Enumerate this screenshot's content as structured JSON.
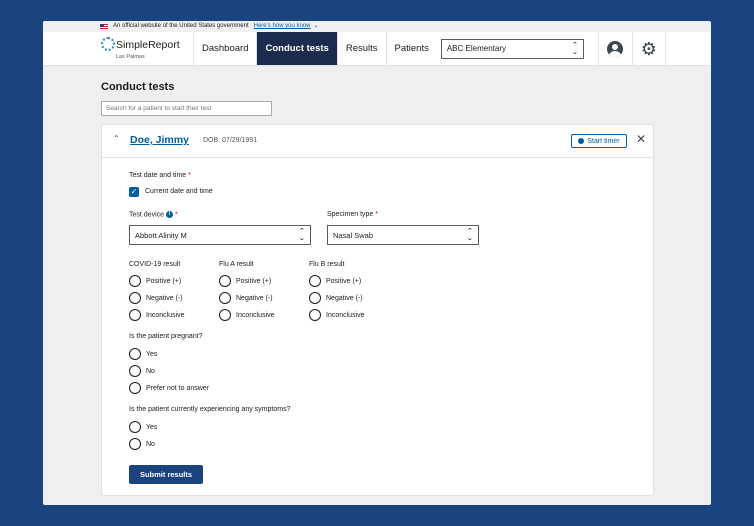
{
  "banner": {
    "text": "An official website of the United States government",
    "link": "Here's how you know"
  },
  "app": {
    "name": "SimpleReport",
    "site": "Las Palmas"
  },
  "nav": {
    "dashboard": "Dashboard",
    "conduct": "Conduct tests",
    "results": "Results",
    "patients": "Patients"
  },
  "facility": {
    "selected": "ABC Elementary"
  },
  "page": {
    "title": "Conduct tests"
  },
  "search": {
    "placeholder": "Search for a patient to start their test"
  },
  "patient": {
    "name": "Doe, Jimmy",
    "dob": "DOB: 07/29/1991",
    "timer_label": "Start timer"
  },
  "form": {
    "datetime_label": "Test date and time",
    "current_datetime_label": "Current date and time",
    "current_datetime_checked": true,
    "device_label": "Test device",
    "device_value": "Abbott Alinity M",
    "specimen_label": "Specimen type",
    "specimen_value": "Nasal Swab",
    "result_groups": [
      {
        "label": "COVID-19 result",
        "options": [
          "Positive (+)",
          "Negative (-)",
          "Inconclusive"
        ]
      },
      {
        "label": "Flu A result",
        "options": [
          "Positive (+)",
          "Negative (-)",
          "Inconclusive"
        ]
      },
      {
        "label": "Flu B result",
        "options": [
          "Positive (+)",
          "Negative (-)",
          "Inconclusive"
        ]
      }
    ],
    "pregnant_label": "Is the patient pregnant?",
    "pregnant_options": [
      "Yes",
      "No",
      "Prefer not to answer"
    ],
    "symptoms_label": "Is the patient currently experiencing any symptoms?",
    "symptoms_options": [
      "Yes",
      "No"
    ],
    "submit_label": "Submit results"
  },
  "colors": {
    "brand": "#1a4480",
    "accent": "#005ea2",
    "nav_active": "#1c2c4f",
    "required": "#b50909"
  }
}
